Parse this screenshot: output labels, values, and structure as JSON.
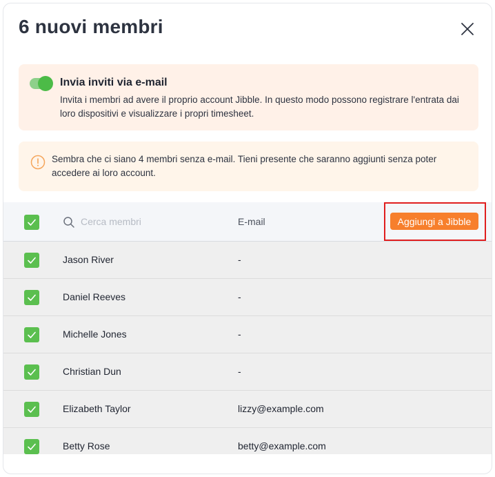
{
  "modal": {
    "title": "6 nuovi membri",
    "close_icon": "close-icon"
  },
  "invite": {
    "enabled": true,
    "title": "Invia inviti via e-mail",
    "text": "Invita i membri ad avere il proprio account Jibble. In questo modo possono registrare l'entrata dai loro dispositivi e visualizzare i propri timesheet."
  },
  "warning": {
    "icon": "warning-icon",
    "text": "Sembra che ci siano 4 membri senza e-mail. Tieni presente che saranno aggiunti senza poter accedere ai loro account."
  },
  "table": {
    "select_all_checked": true,
    "search_placeholder": "Cerca membri",
    "email_header": "E-mail",
    "add_button": "Aggiungi a Jibble",
    "rows": [
      {
        "name": "Jason River",
        "email": "-",
        "checked": true
      },
      {
        "name": "Daniel Reeves",
        "email": "-",
        "checked": true
      },
      {
        "name": "Michelle Jones",
        "email": "-",
        "checked": true
      },
      {
        "name": "Christian Dun",
        "email": "-",
        "checked": true
      },
      {
        "name": "Elizabeth Taylor",
        "email": "lizzy@example.com",
        "checked": true
      },
      {
        "name": "Betty Rose",
        "email": "betty@example.com",
        "checked": true
      }
    ]
  },
  "colors": {
    "accent_orange": "#f77f2c",
    "check_green": "#5bbf4f",
    "highlight_red": "#e01d1d",
    "invite_bg": "#fff1e8",
    "warning_bg": "#fff5ea"
  }
}
